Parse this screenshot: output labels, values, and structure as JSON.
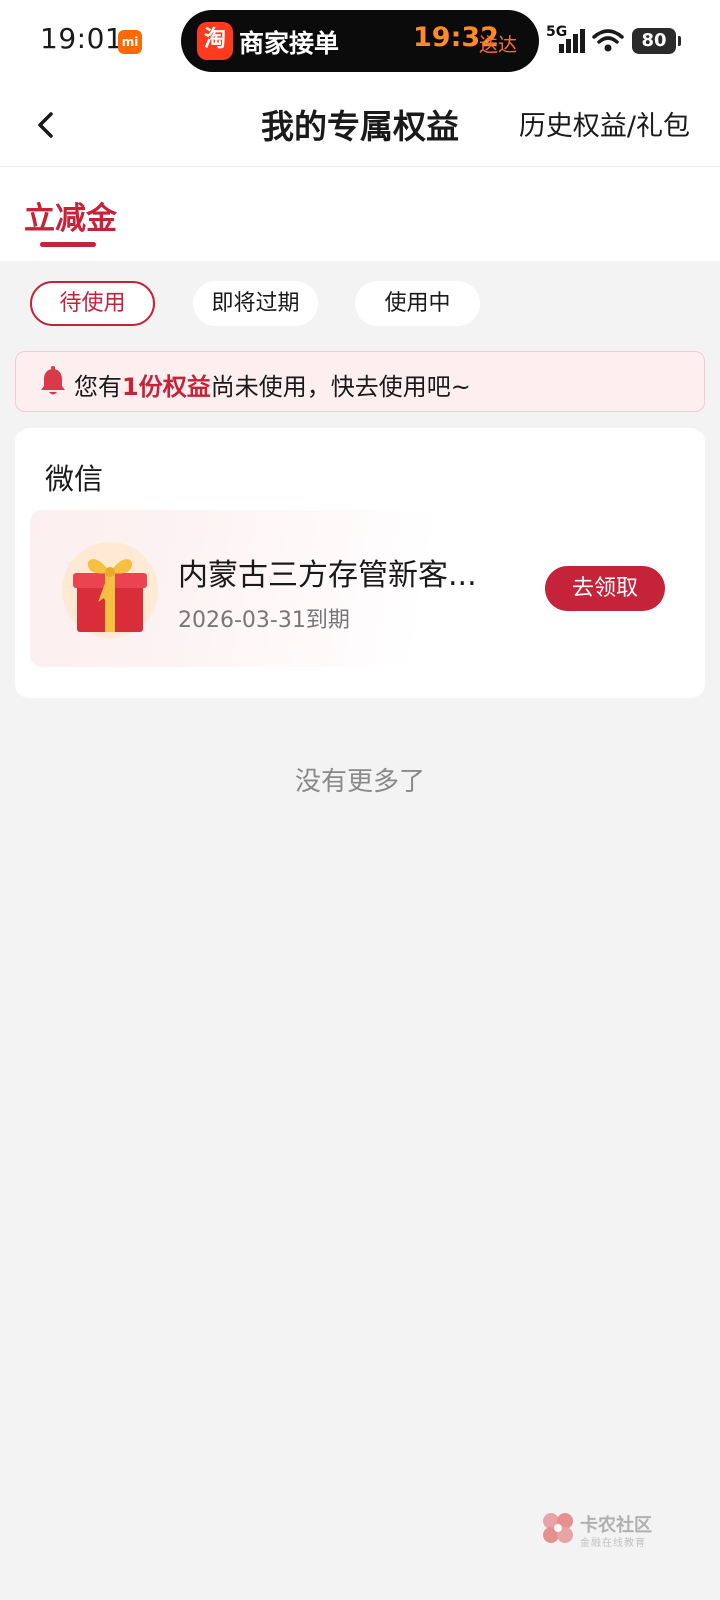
{
  "status_bar": {
    "time": "19:01",
    "mi_badge": "mi",
    "island": {
      "app_glyph": "淘",
      "label": "商家接单",
      "eta": "19:32",
      "eta_tag": "送达"
    },
    "network": "5G",
    "battery": "80"
  },
  "header": {
    "title": "我的专属权益",
    "history_link": "历史权益/礼包",
    "back_icon": "chevron-left-icon"
  },
  "tabs": [
    {
      "label": "立减金",
      "active": true
    }
  ],
  "filters": [
    {
      "label": "待使用",
      "selected": true
    },
    {
      "label": "即将过期",
      "selected": false
    },
    {
      "label": "使用中",
      "selected": false
    }
  ],
  "notice": {
    "icon": "bell-icon",
    "prefix": "您有",
    "highlight": "1份权益",
    "suffix": "尚未使用，快去使用吧~"
  },
  "sections": [
    {
      "title": "微信",
      "items": [
        {
          "icon": "gift-box-icon",
          "title": "内蒙古三方存管新客...",
          "expiry": "2026-03-31到期",
          "action": "去领取"
        }
      ]
    }
  ],
  "list_end_text": "没有更多了",
  "watermark": {
    "title": "卡农社区",
    "subtitle": "金融在线教育"
  },
  "colors": {
    "accent": "#c4233a",
    "notice_bg": "#fdeff0",
    "page_bg": "#f3f3f3"
  }
}
